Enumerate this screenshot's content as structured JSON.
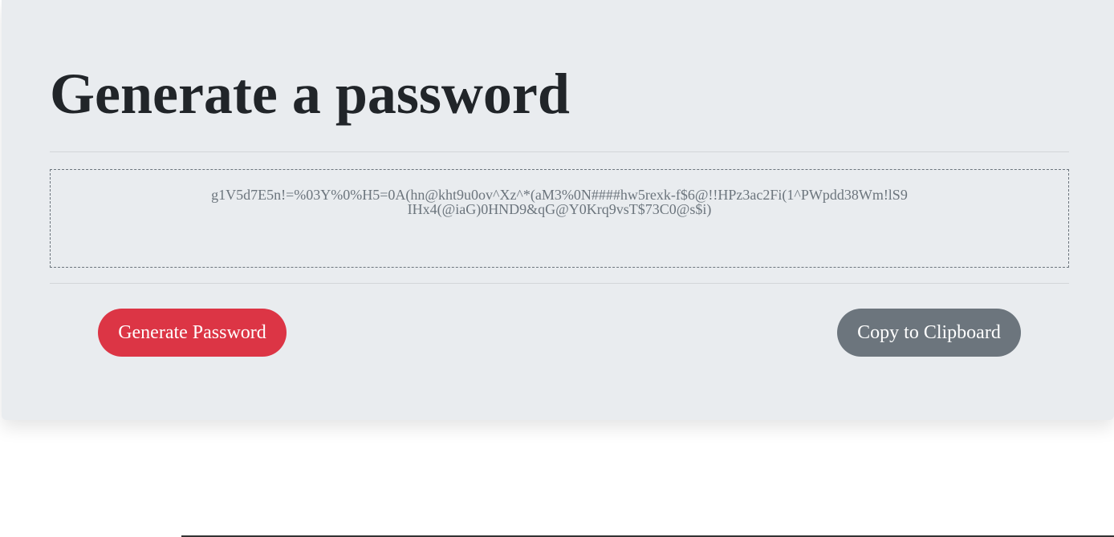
{
  "page": {
    "title": "Generate a password"
  },
  "password": {
    "value": "g1V5d7E5n!=%03Y%0%H5=0A(hn@kht9u0ov^Xz^*(aM3%0N####hw5rexk-f$6@!!HPz3ac2Fi(1^PWpdd38Wm!lS9IHx4(@iaG)0HND9&qG@Y0Krq9vsT$73C0@s$i)"
  },
  "buttons": {
    "generate_label": "Generate Password",
    "copy_label": "Copy to Clipboard"
  },
  "colors": {
    "card_background": "#e9ecef",
    "generate_button": "#dc3545",
    "copy_button": "#6c757d",
    "title_text": "#212529",
    "password_text": "#6c757d"
  }
}
